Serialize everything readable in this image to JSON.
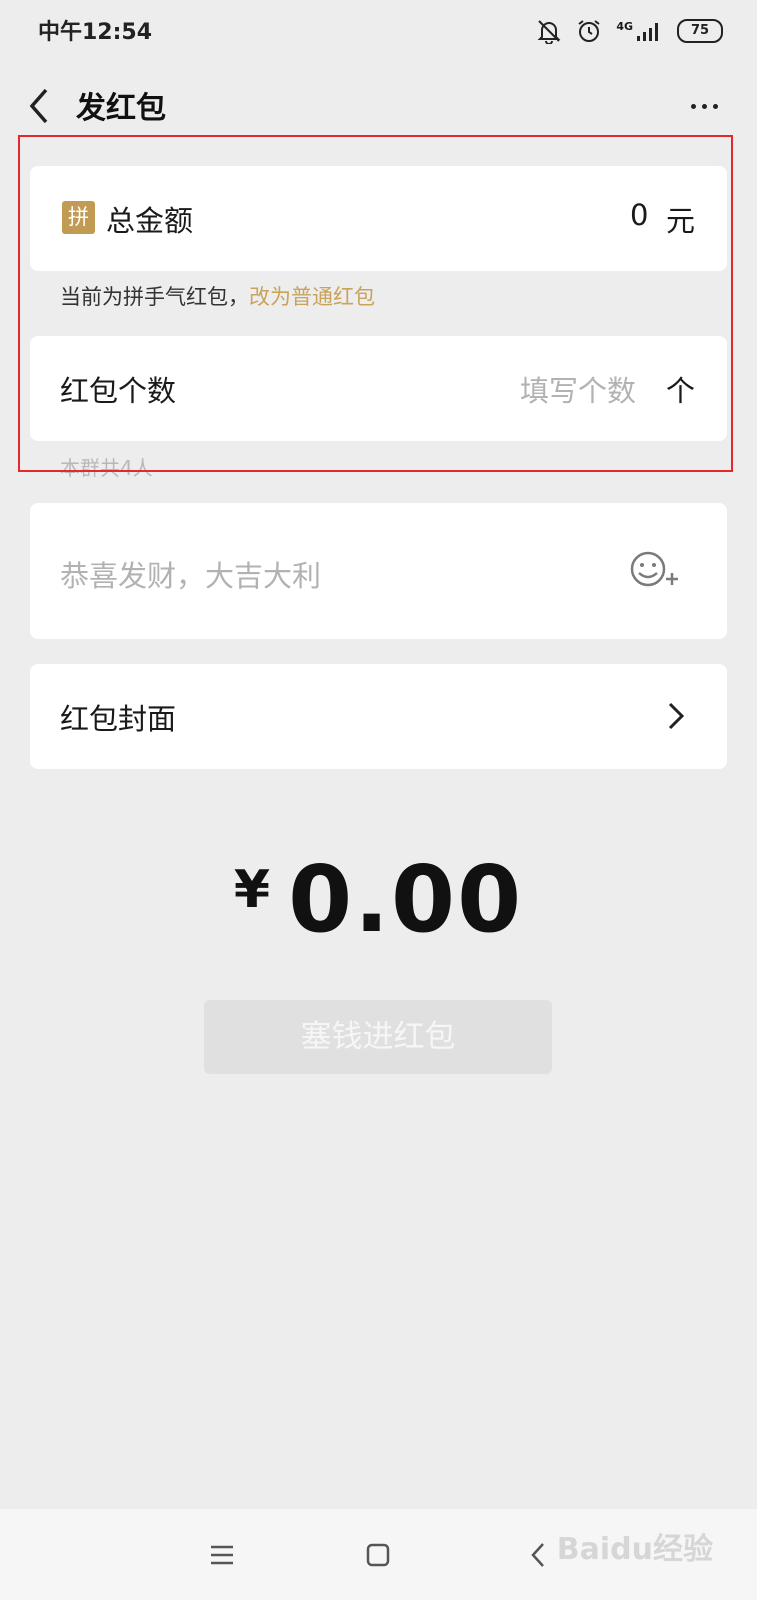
{
  "status_bar": {
    "time": "中午12:54",
    "network": "4G",
    "battery": "75"
  },
  "header": {
    "title": "发红包"
  },
  "total_amount": {
    "badge": "拼",
    "label": "总金额",
    "value": "0",
    "unit": "元"
  },
  "mode_hint": {
    "text": "当前为拼手气红包，",
    "link": "改为普通红包"
  },
  "count": {
    "label": "红包个数",
    "placeholder": "填写个数",
    "unit": "个"
  },
  "group_hint": "本群共4人",
  "message": {
    "placeholder": "恭喜发财，大吉大利"
  },
  "cover": {
    "label": "红包封面"
  },
  "summary": {
    "currency": "¥",
    "amount": "0.00"
  },
  "submit": {
    "label": "塞钱进红包"
  },
  "watermark": "Baidu经验",
  "colors": {
    "accent": "#c19a53",
    "link": "#c9a35a",
    "highlight": "#e32a2a",
    "background": "#ededed"
  }
}
